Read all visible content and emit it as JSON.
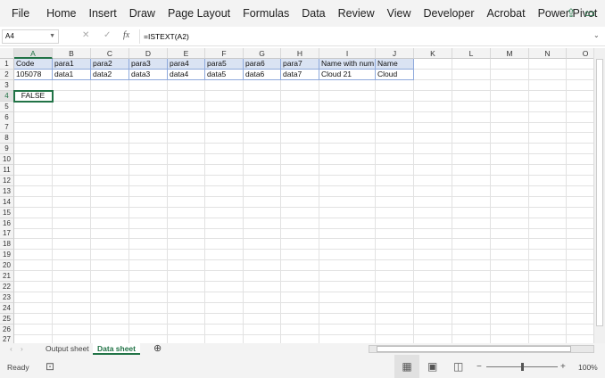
{
  "ribbon": {
    "tabs": [
      "File",
      "Home",
      "Insert",
      "Draw",
      "Page Layout",
      "Formulas",
      "Data",
      "Review",
      "View",
      "Developer",
      "Acrobat",
      "Power Pivot"
    ]
  },
  "formula_bar": {
    "name_box": "A4",
    "formula": "=ISTEXT(A2)"
  },
  "columns": [
    "A",
    "B",
    "C",
    "D",
    "E",
    "F",
    "G",
    "H",
    "I",
    "J",
    "K",
    "L",
    "M",
    "N",
    "O"
  ],
  "row_count": 27,
  "rows": [
    [
      "Code",
      "para1",
      "para2",
      "para3",
      "para4",
      "para5",
      "para6",
      "para7",
      "Name with num",
      "Name"
    ],
    [
      "105078",
      "data1",
      "data2",
      "data3",
      "data4",
      "data5",
      "data6",
      "data7",
      "Cloud 21",
      "Cloud"
    ]
  ],
  "active_cell": {
    "ref": "A4",
    "value": "FALSE"
  },
  "sheets": {
    "tabs": [
      "Output sheet",
      "Data sheet"
    ],
    "active": "Data sheet"
  },
  "status": {
    "mode": "Ready",
    "zoom": "100%",
    "zoom_fraction": 0.5
  },
  "colors": {
    "accent": "#217346",
    "header_fill": "#dae3f3"
  }
}
